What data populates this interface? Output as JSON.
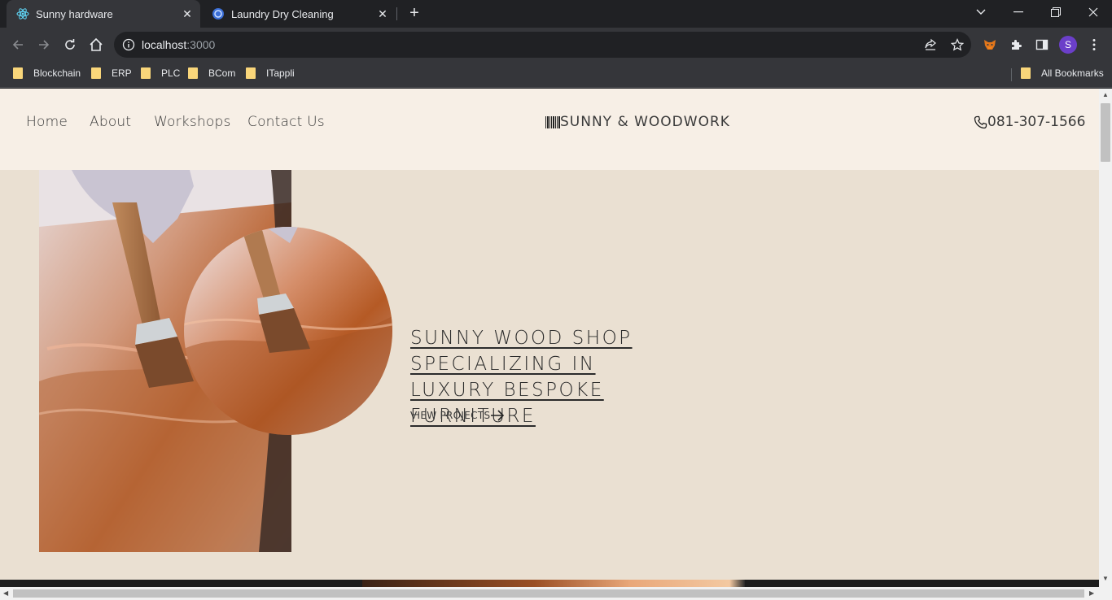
{
  "browser": {
    "tabs": [
      {
        "title": "Sunny hardware",
        "active": true
      },
      {
        "title": "Laundry Dry Cleaning",
        "active": false
      }
    ],
    "url": {
      "host": "localhost",
      "port": ":3000"
    },
    "profile_initial": "S",
    "bookmarks": [
      "Blockchain",
      "ERP",
      "PLC",
      "BCom",
      "ITappli"
    ],
    "all_bookmarks": "All Bookmarks"
  },
  "site": {
    "nav": [
      "Home",
      "About",
      "Workshops",
      "Contact Us"
    ],
    "brand": "SUNNY & WOODWORK",
    "phone": "081-307-1566",
    "hero": {
      "title": "SUNNY WOOD SHOP SPECIALIZING IN LUXURY BESPOKE FURNITURE",
      "cta": "VIEW PROJECTS"
    }
  }
}
